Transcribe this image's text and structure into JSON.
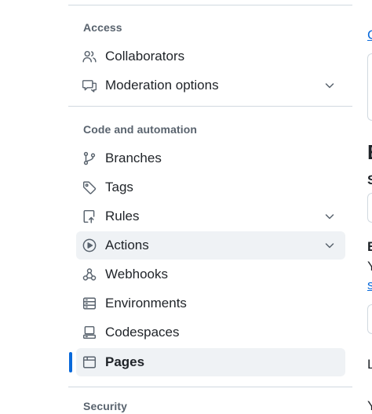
{
  "sidebar": {
    "sections": [
      {
        "title": "Access",
        "items": [
          {
            "label": "Collaborators",
            "icon": "people-icon"
          },
          {
            "label": "Moderation options",
            "icon": "report-icon",
            "expandable": true
          }
        ]
      },
      {
        "title": "Code and automation",
        "items": [
          {
            "label": "Branches",
            "icon": "git-branch-icon"
          },
          {
            "label": "Tags",
            "icon": "tag-icon"
          },
          {
            "label": "Rules",
            "icon": "repo-push-icon",
            "expandable": true
          },
          {
            "label": "Actions",
            "icon": "play-icon",
            "expandable": true,
            "hovered": true
          },
          {
            "label": "Webhooks",
            "icon": "webhook-icon"
          },
          {
            "label": "Environments",
            "icon": "server-icon"
          },
          {
            "label": "Codespaces",
            "icon": "codespaces-icon"
          },
          {
            "label": "Pages",
            "icon": "browser-icon",
            "selected": true
          }
        ]
      },
      {
        "title": "Security",
        "items": []
      }
    ]
  },
  "main_partial": {
    "fragments": [
      "C",
      "E",
      "S",
      "E",
      "Y",
      "s",
      "L",
      "Y"
    ]
  },
  "colors": {
    "accent": "#0969da",
    "hover_bg": "#eff2f5",
    "border": "#d1d9e0",
    "muted_text": "#59636e"
  }
}
